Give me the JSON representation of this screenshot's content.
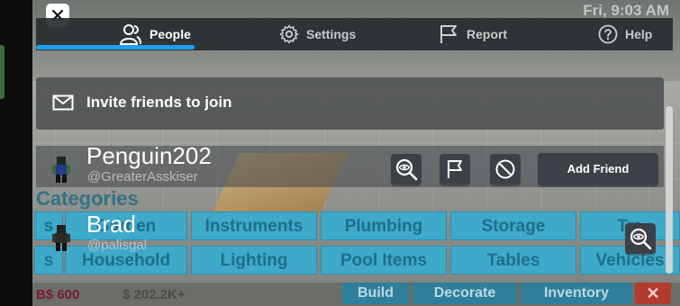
{
  "background": {
    "clock": "Fri, 9:03 AM",
    "categories_title": "Categories",
    "categories": [
      [
        "s",
        "Garden",
        "Instruments",
        "Plumbing",
        "Storage",
        "Tra"
      ],
      [
        "s",
        "Household",
        "Lighting",
        "Pool Items",
        "Tables",
        "Vehicles"
      ]
    ],
    "currency": "B$ 600",
    "money": "$ 202.2K+",
    "bottom_buttons": [
      "Build",
      "Decorate",
      "Inventory"
    ]
  },
  "menu": {
    "close_icon": "close-icon",
    "tabs": [
      {
        "label": "People",
        "icon": "people-icon",
        "active": true
      },
      {
        "label": "Settings",
        "icon": "gear-icon",
        "active": false
      },
      {
        "label": "Report",
        "icon": "flag-icon",
        "active": false
      },
      {
        "label": "Help",
        "icon": "help-icon",
        "active": false
      }
    ],
    "invite_label": "Invite friends to join",
    "players": [
      {
        "name": "Penguin202",
        "handle": "@GreaterAsskiser",
        "action": "Add Friend"
      },
      {
        "name": "Brad",
        "handle": "@palisgal"
      }
    ],
    "accent_color": "#1ea1f2"
  }
}
